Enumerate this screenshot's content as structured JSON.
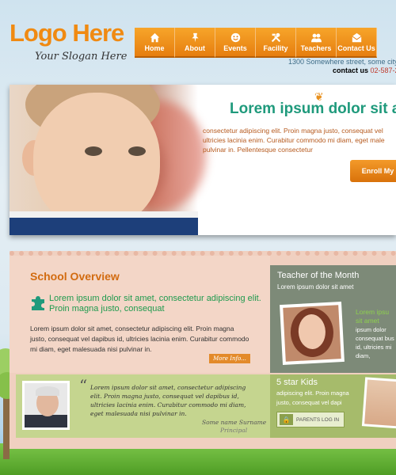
{
  "header": {
    "logo": "Logo Here",
    "slogan": "Your Slogan Here",
    "address": "1300 Somewhere street, some city,",
    "contact_label": "contact us",
    "phone": "02-587-2"
  },
  "nav": {
    "items": [
      {
        "label": "Home",
        "icon": "home-icon"
      },
      {
        "label": "About",
        "icon": "pin-icon"
      },
      {
        "label": "Events",
        "icon": "smiley-icon"
      },
      {
        "label": "Facility",
        "icon": "tools-icon"
      },
      {
        "label": "Teachers",
        "icon": "people-icon"
      },
      {
        "label": "Contact Us",
        "icon": "envelope-icon"
      }
    ]
  },
  "hero": {
    "title": "Lorem ipsum dolor sit amet",
    "text": "consectetur adipiscing elit. Proin magna justo, consequat vel ultricies lacinia enim. Curabitur commodo mi diam, eget male pulvinar in. Pellentesque consectetur",
    "enroll_label": "Enroll My"
  },
  "overview": {
    "title": "School Overview",
    "lead": "Lorem ipsum dolor sit amet, consectetur adipiscing elit. Proin magna justo, consequat",
    "body": "Lorem ipsum dolor sit amet, consectetur adipiscing elit. Proin magna justo, consequat vel dapibus id, ultricies lacinia enim. Curabitur commodo mi diam, eget malesuada nisi pulvinar in.",
    "more_info": "More Info..."
  },
  "quote": {
    "mark": "“",
    "text": "Lorem ipsum dolor sit amet, consectetur adipiscing elit. Proin magna justo, consequat vel dapibus id, ultricies lacinia enim. Curabitur commodo mi diam, eget malesuada nisi pulvinar in.",
    "name": "Some name Surname",
    "role": "Principal"
  },
  "teacher": {
    "title": "Teacher of the Month",
    "subtitle": "Lorem ipsum dolor sit amet",
    "highlight": "Lorem ipsu sit amet",
    "body": "ipsum dolor consequat bus id, ultricies mi diam,"
  },
  "kids": {
    "title": "5 star Kids",
    "text": "adipiscing elit. Proin magna justo, consequat vel dapi",
    "parents_login": "PARENTS LOG IN"
  },
  "colors": {
    "accent": "#f08a12",
    "teal": "#1f9a7c",
    "green": "#1f9a4e"
  }
}
